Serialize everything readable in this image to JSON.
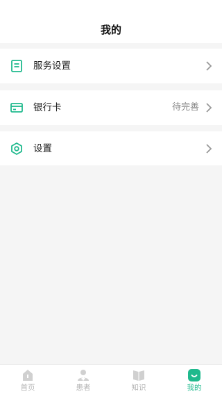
{
  "header": {
    "title": "我的"
  },
  "menu": {
    "items": [
      {
        "label": "服务设置",
        "value": "",
        "icon": "bookmark-icon"
      },
      {
        "label": "银行卡",
        "value": "待完善",
        "icon": "card-icon"
      },
      {
        "label": "设置",
        "value": "",
        "icon": "settings-icon"
      }
    ]
  },
  "tabbar": {
    "tabs": [
      {
        "label": "首页",
        "icon": "home-icon",
        "active": false
      },
      {
        "label": "患者",
        "icon": "patient-icon",
        "active": false
      },
      {
        "label": "知识",
        "icon": "book-icon",
        "active": false
      },
      {
        "label": "我的",
        "icon": "smile-icon",
        "active": true
      }
    ]
  },
  "colors": {
    "accent": "#1fb98d",
    "background": "#f5f5f5",
    "inactive_tab": "#b5b5b5",
    "secondary_text": "#888888"
  }
}
